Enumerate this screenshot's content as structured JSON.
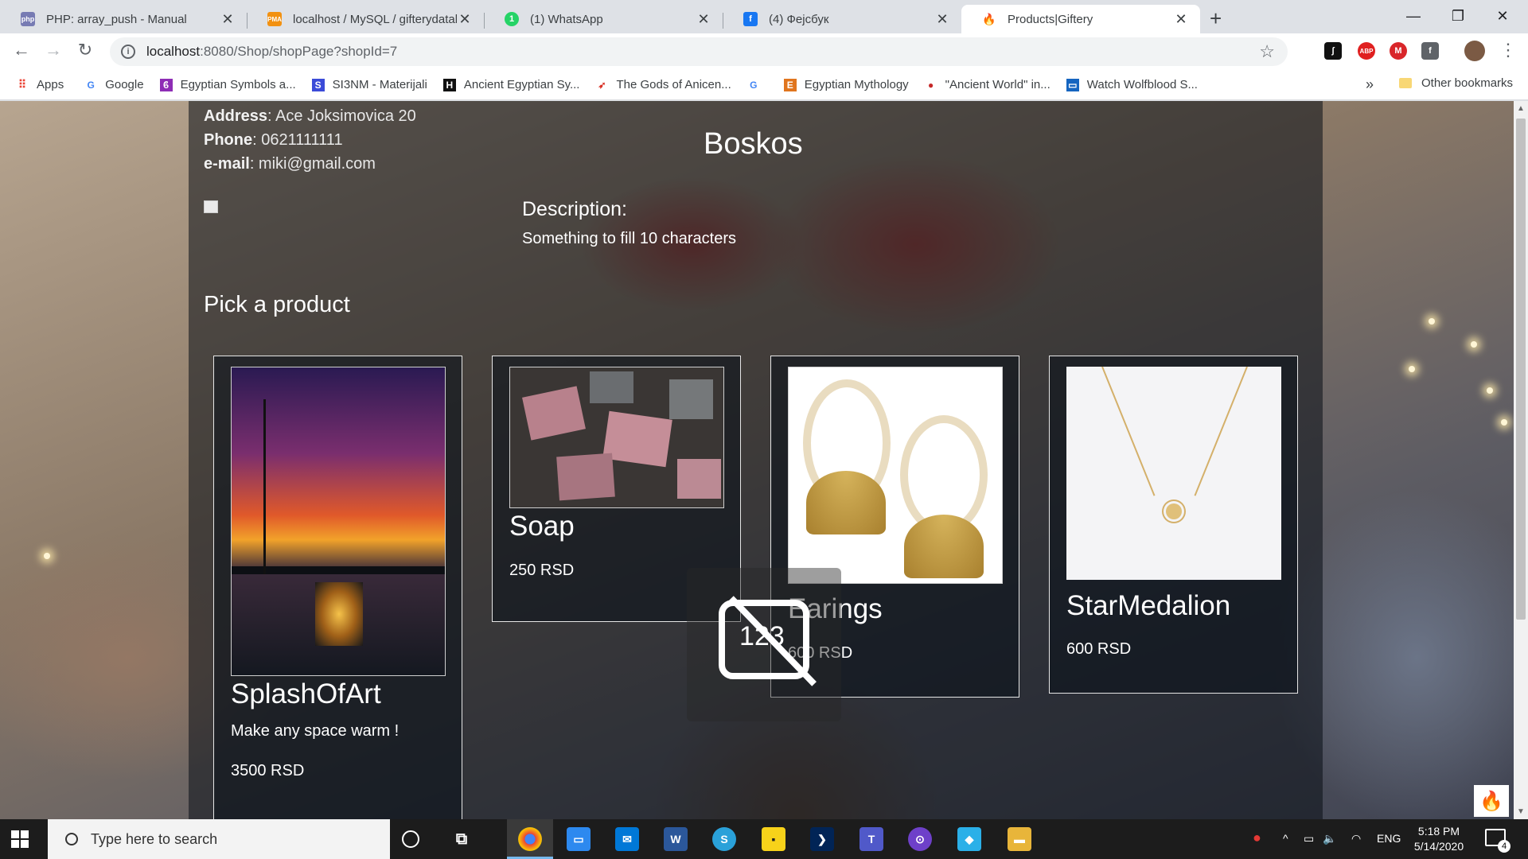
{
  "browser": {
    "tabs": [
      {
        "title": "PHP: array_push - Manual",
        "favicon": "php",
        "color": "#777bb3"
      },
      {
        "title": "localhost / MySQL / gifterydatab",
        "favicon": "pma",
        "color": "#f29111"
      },
      {
        "title": "(1) WhatsApp",
        "favicon": "1",
        "color": "#25d366"
      },
      {
        "title": "(4) Фејсбук",
        "favicon": "f",
        "color": "#1877f2"
      },
      {
        "title": "Products|Giftery",
        "favicon": "🔥",
        "color": "#e8511f"
      }
    ],
    "active_tab": 4,
    "url_host": "localhost",
    "url_path": ":8080/Shop/shopPage?shopId=7",
    "bookmarks": [
      {
        "label": "Apps",
        "icon": "apps-icon"
      },
      {
        "label": "Google",
        "icon": "google-icon"
      },
      {
        "label": "Egyptian Symbols a...",
        "icon": "bookmark-icon"
      },
      {
        "label": "SI3NM - Materijali",
        "icon": "bookmark-icon"
      },
      {
        "label": "Ancient Egyptian Sy...",
        "icon": "bookmark-icon"
      },
      {
        "label": "The Gods of Anicen...",
        "icon": "bookmark-icon"
      },
      {
        "label": "",
        "icon": "google-icon"
      },
      {
        "label": "Egyptian Mythology",
        "icon": "bookmark-icon"
      },
      {
        "label": "\"Ancient World\" in...",
        "icon": "bookmark-icon"
      },
      {
        "label": "Watch Wolfblood S...",
        "icon": "bookmark-icon"
      }
    ],
    "bookmarks_more": "»",
    "other_bookmarks": "Other bookmarks"
  },
  "shop": {
    "address_label": "Address",
    "address": ": Ace Joksimovica 20",
    "phone_label": "Phone",
    "phone": ": 0621111111",
    "email_label": "e-mail",
    "email": ": miki@gmail.com",
    "name": "Boskos",
    "description_label": "Description:",
    "description": "Something to fill 10 characters",
    "pick_label": "Pick a product"
  },
  "products": [
    {
      "name": "SplashOfArt",
      "subtitle": "Make any space warm !",
      "price": "3500 RSD"
    },
    {
      "name": "Soap",
      "subtitle": "",
      "price": "250 RSD"
    },
    {
      "name": "Earings",
      "subtitle": "",
      "price": "600 RSD"
    },
    {
      "name": "StarMedalion",
      "subtitle": "",
      "price": "600 RSD"
    }
  ],
  "osd": {
    "text": "123"
  },
  "taskbar": {
    "search_placeholder": "Type here to search",
    "language": "ENG",
    "time": "5:18 PM",
    "date": "5/14/2020",
    "notification_count": "4"
  }
}
